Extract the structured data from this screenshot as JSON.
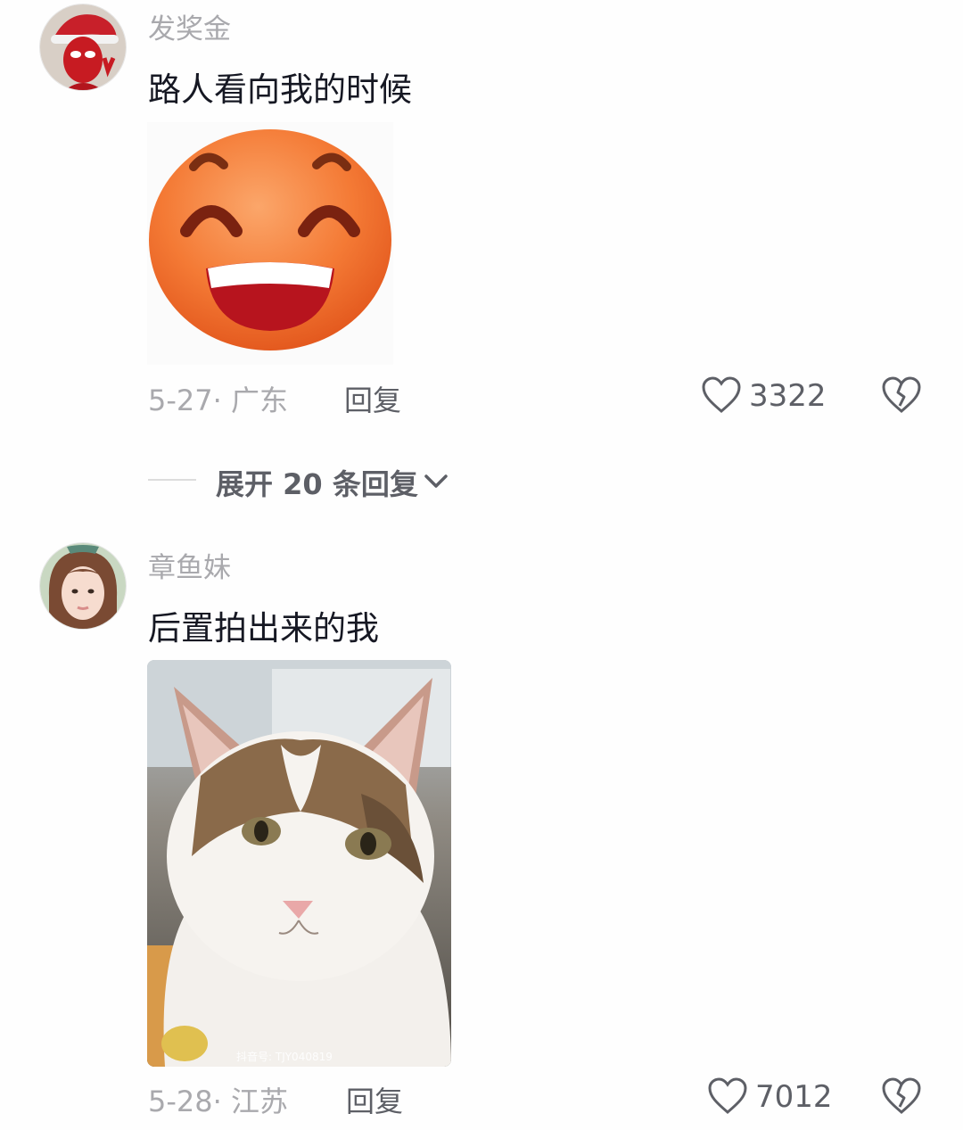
{
  "comments": [
    {
      "username": "发奖金",
      "text": "路人看向我的时候",
      "date": "5-27",
      "location": "广东",
      "reply_label": "回复",
      "likes": "3322",
      "avatar_icon": "spiderman-avatar",
      "image": "orange-grinning-emoji"
    },
    {
      "username": "章鱼妹",
      "text": "后置拍出来的我",
      "date": "5-28",
      "location": "江苏",
      "reply_label": "回复",
      "likes": "7012",
      "avatar_icon": "girl-avatar",
      "image": "cat-photo",
      "image_watermark": "抖音号: TJY040819"
    }
  ],
  "expand_replies": {
    "label": "展开 20 条回复"
  },
  "colors": {
    "text": "#161823",
    "secondary": "#a9a9ad",
    "emoji_orange": "#f47a35"
  }
}
